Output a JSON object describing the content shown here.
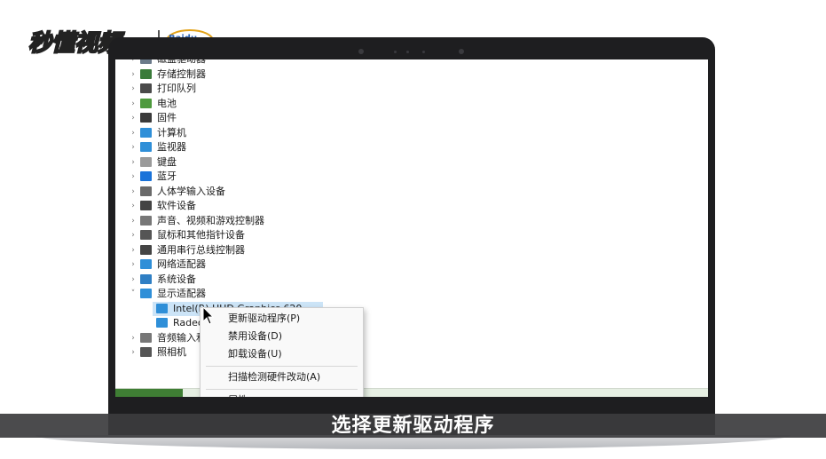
{
  "branding": {
    "logo_text": "秒懂视频",
    "partner_text": "Baidu"
  },
  "device_manager": {
    "categories": [
      {
        "label": "磁盘驱动器",
        "icon": "disk-drive-icon",
        "expanded": false
      },
      {
        "label": "存储控制器",
        "icon": "storage-controller-icon",
        "expanded": false
      },
      {
        "label": "打印队列",
        "icon": "printer-icon",
        "expanded": false
      },
      {
        "label": "电池",
        "icon": "battery-icon",
        "expanded": false
      },
      {
        "label": "固件",
        "icon": "firmware-icon",
        "expanded": false
      },
      {
        "label": "计算机",
        "icon": "computer-icon",
        "expanded": false
      },
      {
        "label": "监视器",
        "icon": "monitor-icon",
        "expanded": false
      },
      {
        "label": "键盘",
        "icon": "keyboard-icon",
        "expanded": false
      },
      {
        "label": "蓝牙",
        "icon": "bluetooth-icon",
        "expanded": false
      },
      {
        "label": "人体学输入设备",
        "icon": "hid-icon",
        "expanded": false
      },
      {
        "label": "软件设备",
        "icon": "software-device-icon",
        "expanded": false
      },
      {
        "label": "声音、视频和游戏控制器",
        "icon": "speaker-icon",
        "expanded": false
      },
      {
        "label": "鼠标和其他指针设备",
        "icon": "mouse-icon",
        "expanded": false
      },
      {
        "label": "通用串行总线控制器",
        "icon": "usb-icon",
        "expanded": false
      },
      {
        "label": "网络适配器",
        "icon": "network-adapter-icon",
        "expanded": false
      },
      {
        "label": "系统设备",
        "icon": "system-device-icon",
        "expanded": false
      },
      {
        "label": "显示适配器",
        "icon": "display-adapter-icon",
        "expanded": true
      }
    ],
    "display_children": [
      {
        "label": "Intel(R) UHD Graphics 620",
        "icon": "display-adapter-icon",
        "selected": true
      },
      {
        "label": "Radeon",
        "icon": "display-adapter-icon",
        "selected": false
      }
    ],
    "after_categories": [
      {
        "label": "音频输入和输出",
        "icon": "audio-io-icon"
      },
      {
        "label": "照相机",
        "icon": "camera-icon"
      }
    ]
  },
  "context_menu": {
    "items": [
      {
        "label": "更新驱动程序(P)"
      },
      {
        "label": "禁用设备(D)"
      },
      {
        "label": "卸载设备(U)"
      },
      {
        "label": "扫描检测硬件改动(A)"
      },
      {
        "label": "属性"
      }
    ]
  },
  "subtitle": "选择更新驱动程序",
  "colors": {
    "selection": "#cce4f7",
    "taskbar_green": "#3f7e34",
    "monitor_blue": "#2f8fd8"
  }
}
